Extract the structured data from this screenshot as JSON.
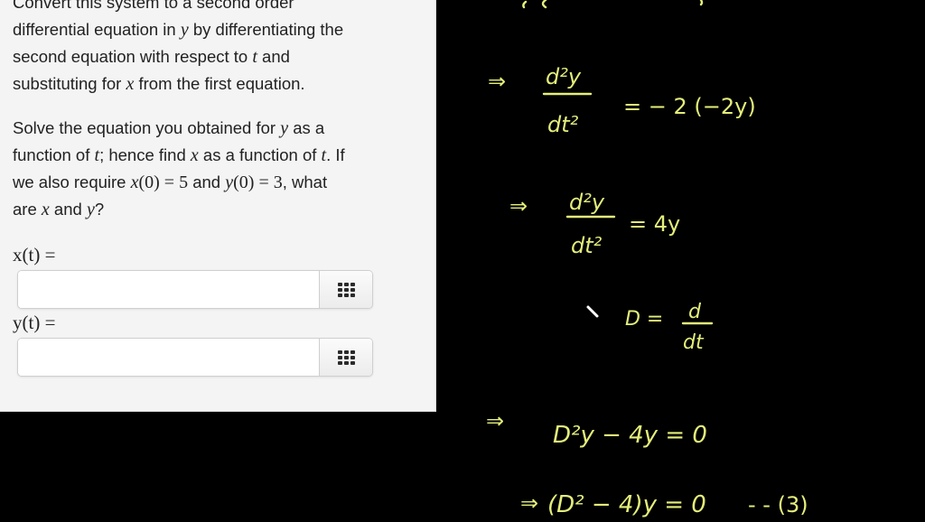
{
  "problem": {
    "paragraph1": {
      "line0": "Convert this system to a second order",
      "line1_pre": "differential equation in ",
      "line1_var": "y",
      "line1_post": " by differentiating the",
      "line2_pre": "second equation with respect to ",
      "line2_var": "t",
      "line2_post": " and",
      "line3_pre": "substituting for ",
      "line3_var": "x",
      "line3_post": " from the first equation."
    },
    "paragraph2": {
      "l1_pre": "Solve the equation you obtained for ",
      "l1_var": "y",
      "l1_post": " as a",
      "l2_pre": "function of ",
      "l2_var1": "t",
      "l2_mid": "; hence find ",
      "l2_var2": "x",
      "l2_mid2": " as a function of ",
      "l2_var3": "t",
      "l2_post": ". If",
      "l3_pre": "we also require ",
      "l3_x": "x",
      "l3_cond1": "(0) = 5",
      "l3_and": " and ",
      "l3_y": "y",
      "l3_cond2": "(0) = 3",
      "l3_post": ", what",
      "l4_pre": "are ",
      "l4_x": "x",
      "l4_and": " and ",
      "l4_y": "y",
      "l4_post": "?"
    }
  },
  "answers": [
    {
      "label": "x(t) =",
      "value": "",
      "keypad_icon": "keypad-grid-icon"
    },
    {
      "label": "y(t) =",
      "value": "",
      "keypad_icon": "keypad-grid-icon"
    }
  ],
  "whiteboard": {
    "ink_color": "#e4ee7a",
    "background": "#000000",
    "lines": [
      {
        "implies": "⇒",
        "lhs_num": "d²y",
        "lhs_den": "dt²",
        "rhs": "= − 2 (−2y)"
      },
      {
        "implies": "⇒",
        "lhs_num": "d²y",
        "lhs_den": "dt²",
        "rhs": "= 4y"
      },
      {
        "lhs": "D =",
        "rhs_num": "d",
        "rhs_den": "dt"
      },
      {
        "implies": "⇒",
        "expr": "D²y − 4y = 0"
      },
      {
        "implies": "⇒",
        "expr": "(D² − 4)y = 0",
        "tag": "- - (3)"
      }
    ]
  }
}
